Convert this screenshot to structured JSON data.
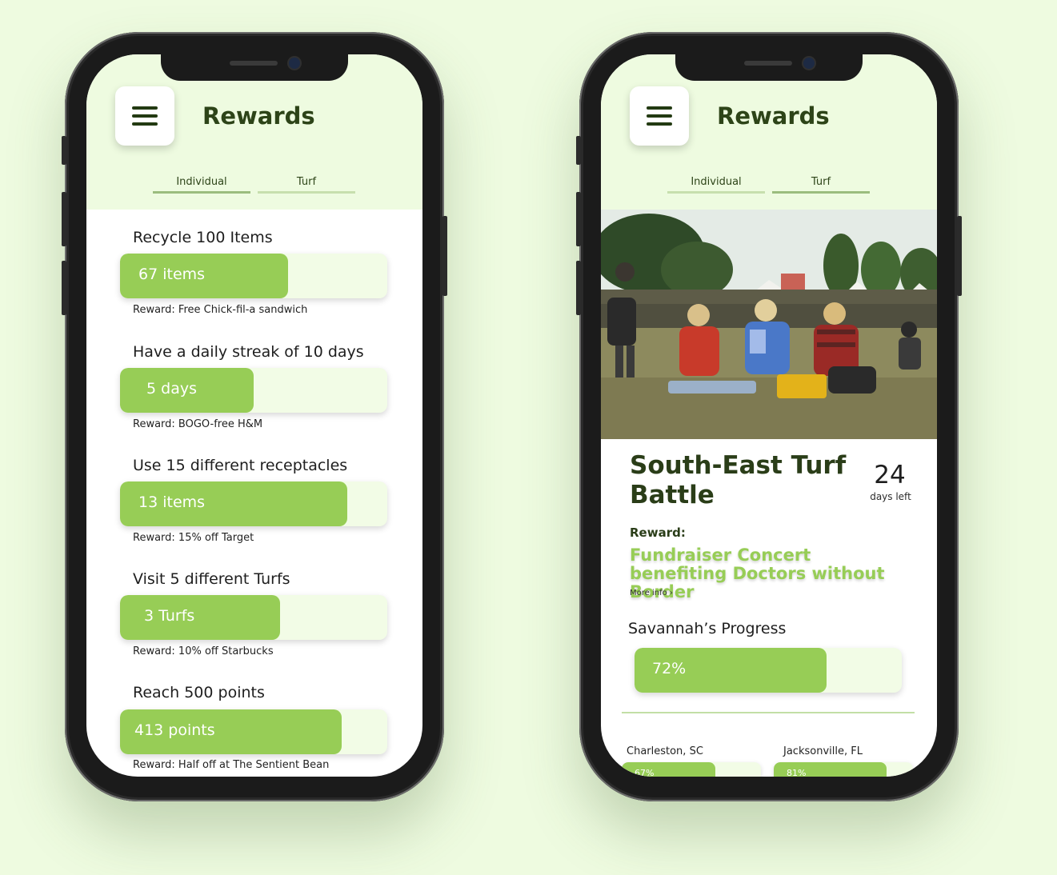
{
  "app": {
    "title": "Rewards",
    "tabs": [
      {
        "label": "Individual"
      },
      {
        "label": "Turf"
      }
    ]
  },
  "individual": {
    "goals": [
      {
        "title": "Recycle 100 Items",
        "progress_label": "67 items",
        "progress": 0.63,
        "reward": "Reward: Free Chick-fil-a sandwich"
      },
      {
        "title": "Have a daily streak of 10 days",
        "progress_label": "5 days",
        "progress": 0.5,
        "reward": "Reward: BOGO-free H&M"
      },
      {
        "title": "Use 15 different receptacles",
        "progress_label": "13 items",
        "progress": 0.85,
        "reward": "Reward: 15% off Target"
      },
      {
        "title": "Visit 5 different Turfs",
        "progress_label": "3 Turfs",
        "progress": 0.6,
        "reward": "Reward: 10% off Starbucks"
      },
      {
        "title": "Reach 500 points",
        "progress_label": "413 points",
        "progress": 0.83,
        "reward": "Reward: Half off at The Sentient Bean"
      }
    ]
  },
  "turf": {
    "battle_title": "South-East Turf Battle",
    "days_left_value": "24",
    "days_left_label": "days left",
    "reward_heading": "Reward:",
    "reward_text": "Fundraiser Concert benefiting Doctors without Border",
    "more_info": "More info ›",
    "progress_title": "Savannah’s Progress",
    "progress_label": "72%",
    "progress": 0.72,
    "cities": [
      {
        "name": "Charleston, SC",
        "progress_label": "67%",
        "progress": 0.67
      },
      {
        "name": "Jacksonville, FL",
        "progress_label": "81%",
        "progress": 0.81
      }
    ]
  },
  "colors": {
    "background": "#eefbe0",
    "accent": "#97cd56",
    "title": "#2d4418"
  },
  "icons": [
    "menu-icon"
  ]
}
